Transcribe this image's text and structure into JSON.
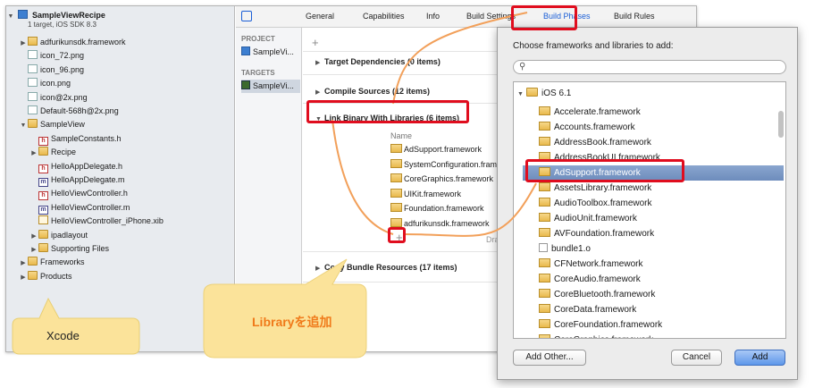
{
  "navigator": {
    "project_name": "SampleViewRecipe",
    "project_subtitle": "1 target, iOS SDK 8.3",
    "items": [
      {
        "label": "adfurikunsdk.framework",
        "icon": "framework-icon",
        "indent": 1,
        "tri": "▶"
      },
      {
        "label": "icon_72.png",
        "icon": "png-file-icon",
        "indent": 1,
        "tri": ""
      },
      {
        "label": "icon_96.png",
        "icon": "png-file-icon",
        "indent": 1,
        "tri": ""
      },
      {
        "label": "icon.png",
        "icon": "png-file-icon",
        "indent": 1,
        "tri": ""
      },
      {
        "label": "icon@2x.png",
        "icon": "png-file-icon",
        "indent": 1,
        "tri": ""
      },
      {
        "label": "Default-568h@2x.png",
        "icon": "png-file-icon",
        "indent": 1,
        "tri": ""
      },
      {
        "label": "SampleView",
        "icon": "folder-icon",
        "indent": 1,
        "tri": "▼"
      },
      {
        "label": "SampleConstants.h",
        "icon": "header-file-icon",
        "indent": 2,
        "tri": ""
      },
      {
        "label": "Recipe",
        "icon": "folder-icon",
        "indent": 2,
        "tri": "▶"
      },
      {
        "label": "HelloAppDelegate.h",
        "icon": "header-file-icon",
        "indent": 2,
        "tri": ""
      },
      {
        "label": "HelloAppDelegate.m",
        "icon": "implementation-file-icon",
        "indent": 2,
        "tri": ""
      },
      {
        "label": "HelloViewController.h",
        "icon": "header-file-icon",
        "indent": 2,
        "tri": ""
      },
      {
        "label": "HelloViewController.m",
        "icon": "implementation-file-icon",
        "indent": 2,
        "tri": ""
      },
      {
        "label": "HelloViewController_iPhone.xib",
        "icon": "xib-file-icon",
        "indent": 2,
        "tri": ""
      },
      {
        "label": "ipadlayout",
        "icon": "folder-icon",
        "indent": 2,
        "tri": "▶"
      },
      {
        "label": "Supporting Files",
        "icon": "folder-icon",
        "indent": 2,
        "tri": "▶"
      },
      {
        "label": "Frameworks",
        "icon": "folder-icon",
        "indent": 1,
        "tri": "▶"
      },
      {
        "label": "Products",
        "icon": "folder-icon",
        "indent": 1,
        "tri": "▶"
      }
    ]
  },
  "targets_column": {
    "project_heading": "PROJECT",
    "project_item": "SampleVi...",
    "targets_heading": "TARGETS",
    "target_item": "SampleVi..."
  },
  "tabs": {
    "general": "General",
    "capabilities": "Capabilities",
    "info": "Info",
    "build_settings": "Build Settings",
    "build_phases": "Build Phases",
    "build_rules": "Build Rules"
  },
  "editor": {
    "add_symbol": "+",
    "target_dependencies": "Target Dependencies (0 items)",
    "compile_sources": "Compile Sources (12 items)",
    "link_binary": "Link Binary With Libraries (6 items)",
    "name_header": "Name",
    "libraries": [
      "AdSupport.framework",
      "SystemConfiguration.framework",
      "CoreGraphics.framework",
      "UIKit.framework",
      "Foundation.framework",
      "adfurikunsdk.framework"
    ],
    "drag_hint": "Drag",
    "copy_bundle": "Copy Bundle Resources (17 items)"
  },
  "dialog": {
    "title": "Choose frameworks and libraries to add:",
    "search_placeholder": "",
    "group": "iOS 6.1",
    "selected_index": 3,
    "frameworks": [
      "Accelerate.framework",
      "Accounts.framework",
      "AddressBook.framework",
      "AddressBookUI.framework",
      "AdSupport.framework",
      "AssetsLibrary.framework",
      "AudioToolbox.framework",
      "AudioUnit.framework",
      "AVFoundation.framework",
      "bundle1.o",
      "CFNetwork.framework",
      "CoreAudio.framework",
      "CoreBluetooth.framework",
      "CoreData.framework",
      "CoreFoundation.framework",
      "CoreGraphics.framework"
    ],
    "add_other": "Add Other...",
    "cancel": "Cancel",
    "add": "Add"
  },
  "callouts": {
    "xcode_label": "Xcode",
    "library_label": "Libraryを追加"
  },
  "colors": {
    "highlight": "#e00d1e",
    "arrow": "#f2a05a",
    "callout_fill": "#fbe39a",
    "callout_text": "#f07a1a",
    "selection": "#6d8cbc"
  }
}
